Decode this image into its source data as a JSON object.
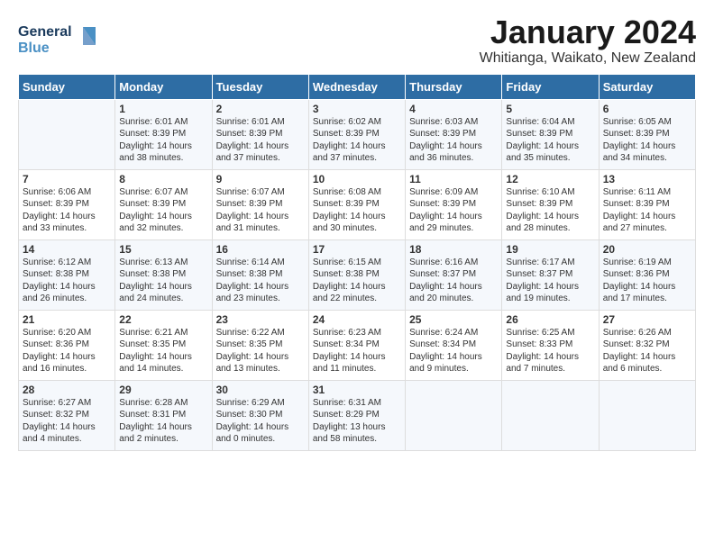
{
  "header": {
    "logo_line1": "General",
    "logo_line2": "Blue",
    "title": "January 2024",
    "subtitle": "Whitianga, Waikato, New Zealand"
  },
  "weekdays": [
    "Sunday",
    "Monday",
    "Tuesday",
    "Wednesday",
    "Thursday",
    "Friday",
    "Saturday"
  ],
  "weeks": [
    [
      {
        "day": "",
        "info": ""
      },
      {
        "day": "1",
        "info": "Sunrise: 6:01 AM\nSunset: 8:39 PM\nDaylight: 14 hours\nand 38 minutes."
      },
      {
        "day": "2",
        "info": "Sunrise: 6:01 AM\nSunset: 8:39 PM\nDaylight: 14 hours\nand 37 minutes."
      },
      {
        "day": "3",
        "info": "Sunrise: 6:02 AM\nSunset: 8:39 PM\nDaylight: 14 hours\nand 37 minutes."
      },
      {
        "day": "4",
        "info": "Sunrise: 6:03 AM\nSunset: 8:39 PM\nDaylight: 14 hours\nand 36 minutes."
      },
      {
        "day": "5",
        "info": "Sunrise: 6:04 AM\nSunset: 8:39 PM\nDaylight: 14 hours\nand 35 minutes."
      },
      {
        "day": "6",
        "info": "Sunrise: 6:05 AM\nSunset: 8:39 PM\nDaylight: 14 hours\nand 34 minutes."
      }
    ],
    [
      {
        "day": "7",
        "info": "Sunrise: 6:06 AM\nSunset: 8:39 PM\nDaylight: 14 hours\nand 33 minutes."
      },
      {
        "day": "8",
        "info": "Sunrise: 6:07 AM\nSunset: 8:39 PM\nDaylight: 14 hours\nand 32 minutes."
      },
      {
        "day": "9",
        "info": "Sunrise: 6:07 AM\nSunset: 8:39 PM\nDaylight: 14 hours\nand 31 minutes."
      },
      {
        "day": "10",
        "info": "Sunrise: 6:08 AM\nSunset: 8:39 PM\nDaylight: 14 hours\nand 30 minutes."
      },
      {
        "day": "11",
        "info": "Sunrise: 6:09 AM\nSunset: 8:39 PM\nDaylight: 14 hours\nand 29 minutes."
      },
      {
        "day": "12",
        "info": "Sunrise: 6:10 AM\nSunset: 8:39 PM\nDaylight: 14 hours\nand 28 minutes."
      },
      {
        "day": "13",
        "info": "Sunrise: 6:11 AM\nSunset: 8:39 PM\nDaylight: 14 hours\nand 27 minutes."
      }
    ],
    [
      {
        "day": "14",
        "info": "Sunrise: 6:12 AM\nSunset: 8:38 PM\nDaylight: 14 hours\nand 26 minutes."
      },
      {
        "day": "15",
        "info": "Sunrise: 6:13 AM\nSunset: 8:38 PM\nDaylight: 14 hours\nand 24 minutes."
      },
      {
        "day": "16",
        "info": "Sunrise: 6:14 AM\nSunset: 8:38 PM\nDaylight: 14 hours\nand 23 minutes."
      },
      {
        "day": "17",
        "info": "Sunrise: 6:15 AM\nSunset: 8:38 PM\nDaylight: 14 hours\nand 22 minutes."
      },
      {
        "day": "18",
        "info": "Sunrise: 6:16 AM\nSunset: 8:37 PM\nDaylight: 14 hours\nand 20 minutes."
      },
      {
        "day": "19",
        "info": "Sunrise: 6:17 AM\nSunset: 8:37 PM\nDaylight: 14 hours\nand 19 minutes."
      },
      {
        "day": "20",
        "info": "Sunrise: 6:19 AM\nSunset: 8:36 PM\nDaylight: 14 hours\nand 17 minutes."
      }
    ],
    [
      {
        "day": "21",
        "info": "Sunrise: 6:20 AM\nSunset: 8:36 PM\nDaylight: 14 hours\nand 16 minutes."
      },
      {
        "day": "22",
        "info": "Sunrise: 6:21 AM\nSunset: 8:35 PM\nDaylight: 14 hours\nand 14 minutes."
      },
      {
        "day": "23",
        "info": "Sunrise: 6:22 AM\nSunset: 8:35 PM\nDaylight: 14 hours\nand 13 minutes."
      },
      {
        "day": "24",
        "info": "Sunrise: 6:23 AM\nSunset: 8:34 PM\nDaylight: 14 hours\nand 11 minutes."
      },
      {
        "day": "25",
        "info": "Sunrise: 6:24 AM\nSunset: 8:34 PM\nDaylight: 14 hours\nand 9 minutes."
      },
      {
        "day": "26",
        "info": "Sunrise: 6:25 AM\nSunset: 8:33 PM\nDaylight: 14 hours\nand 7 minutes."
      },
      {
        "day": "27",
        "info": "Sunrise: 6:26 AM\nSunset: 8:32 PM\nDaylight: 14 hours\nand 6 minutes."
      }
    ],
    [
      {
        "day": "28",
        "info": "Sunrise: 6:27 AM\nSunset: 8:32 PM\nDaylight: 14 hours\nand 4 minutes."
      },
      {
        "day": "29",
        "info": "Sunrise: 6:28 AM\nSunset: 8:31 PM\nDaylight: 14 hours\nand 2 minutes."
      },
      {
        "day": "30",
        "info": "Sunrise: 6:29 AM\nSunset: 8:30 PM\nDaylight: 14 hours\nand 0 minutes."
      },
      {
        "day": "31",
        "info": "Sunrise: 6:31 AM\nSunset: 8:29 PM\nDaylight: 13 hours\nand 58 minutes."
      },
      {
        "day": "",
        "info": ""
      },
      {
        "day": "",
        "info": ""
      },
      {
        "day": "",
        "info": ""
      }
    ]
  ]
}
